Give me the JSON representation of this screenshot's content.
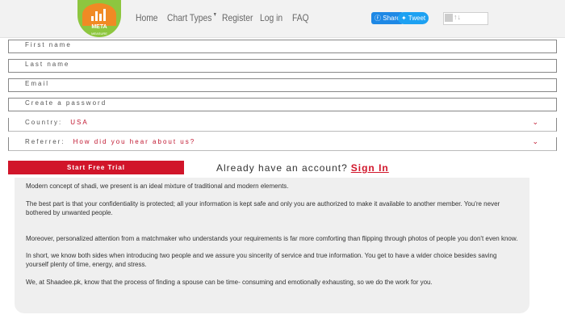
{
  "logo": {
    "text": "META",
    "subtext": "MEASURE"
  },
  "nav": {
    "items": [
      "Home",
      "Chart Types",
      "Register",
      "Log in",
      "FAQ"
    ]
  },
  "social": {
    "share_label": "Share",
    "tweet_label": "Tweet"
  },
  "form": {
    "first_name_placeholder": "First name",
    "last_name_placeholder": "Last name",
    "email_placeholder": "Email",
    "password_placeholder": "Create a password",
    "country_label": "Country:",
    "country_value": "USA",
    "referrer_label": "Referrer:",
    "referrer_value": "How did you hear about us?",
    "submit_label": "Start Free Trial",
    "already_text": "Already have an account?",
    "signin_label": "Sign In"
  },
  "content": {
    "paragraphs": [
      "Modern concept of shadi, we present is an ideal mixture of traditional and modern elements.",
      "The best part is that your confidentiality is protected; all your information is kept safe and only you are authorized to make it available to another member. You're never bothered by unwanted people.",
      "Moreover, personalized attention from a matchmaker who understands your requirements is far more comforting than flipping through photos of people you don't even know.",
      "In short, we know both sides when introducing two people and we assure you sincerity of service and true information. You get to have a wider choice besides saving yourself plenty of time, energy, and stress.",
      "We, at Shaadee.pk, know that the process of finding a spouse can be time- consuming and emotionally exhausting, so we do the work for you."
    ]
  },
  "colors": {
    "accent": "#d1152a",
    "share": "#1e88e5",
    "tweet": "#1da1f2"
  }
}
